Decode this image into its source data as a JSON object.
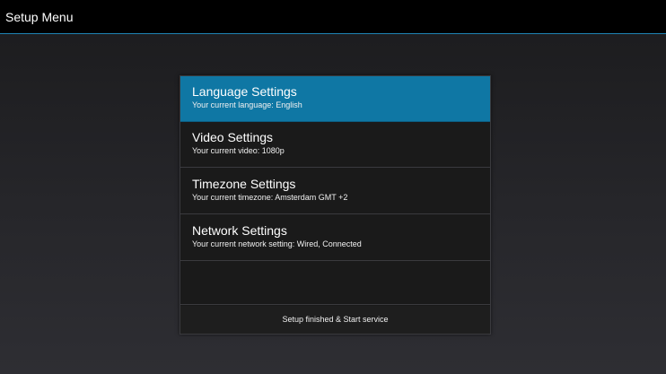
{
  "app": {
    "title": "Setup Menu"
  },
  "theme": {
    "accent": "#1f83b3",
    "selected_row": "#0f77a4",
    "title_bar": "#000000",
    "menu_background": "#1a1a1a"
  },
  "menu": {
    "items": [
      {
        "label": "Language Settings",
        "subtitle": "Your current language: English",
        "selected": true
      },
      {
        "label": "Video Settings",
        "subtitle": "Your current video: 1080p",
        "selected": false
      },
      {
        "label": "Timezone Settings",
        "subtitle": "Your current timezone: Amsterdam GMT +2",
        "selected": false
      },
      {
        "label": "Network Settings",
        "subtitle": "Your current network setting: Wired, Connected",
        "selected": false
      }
    ],
    "footer_label": "Setup finished & Start service"
  }
}
